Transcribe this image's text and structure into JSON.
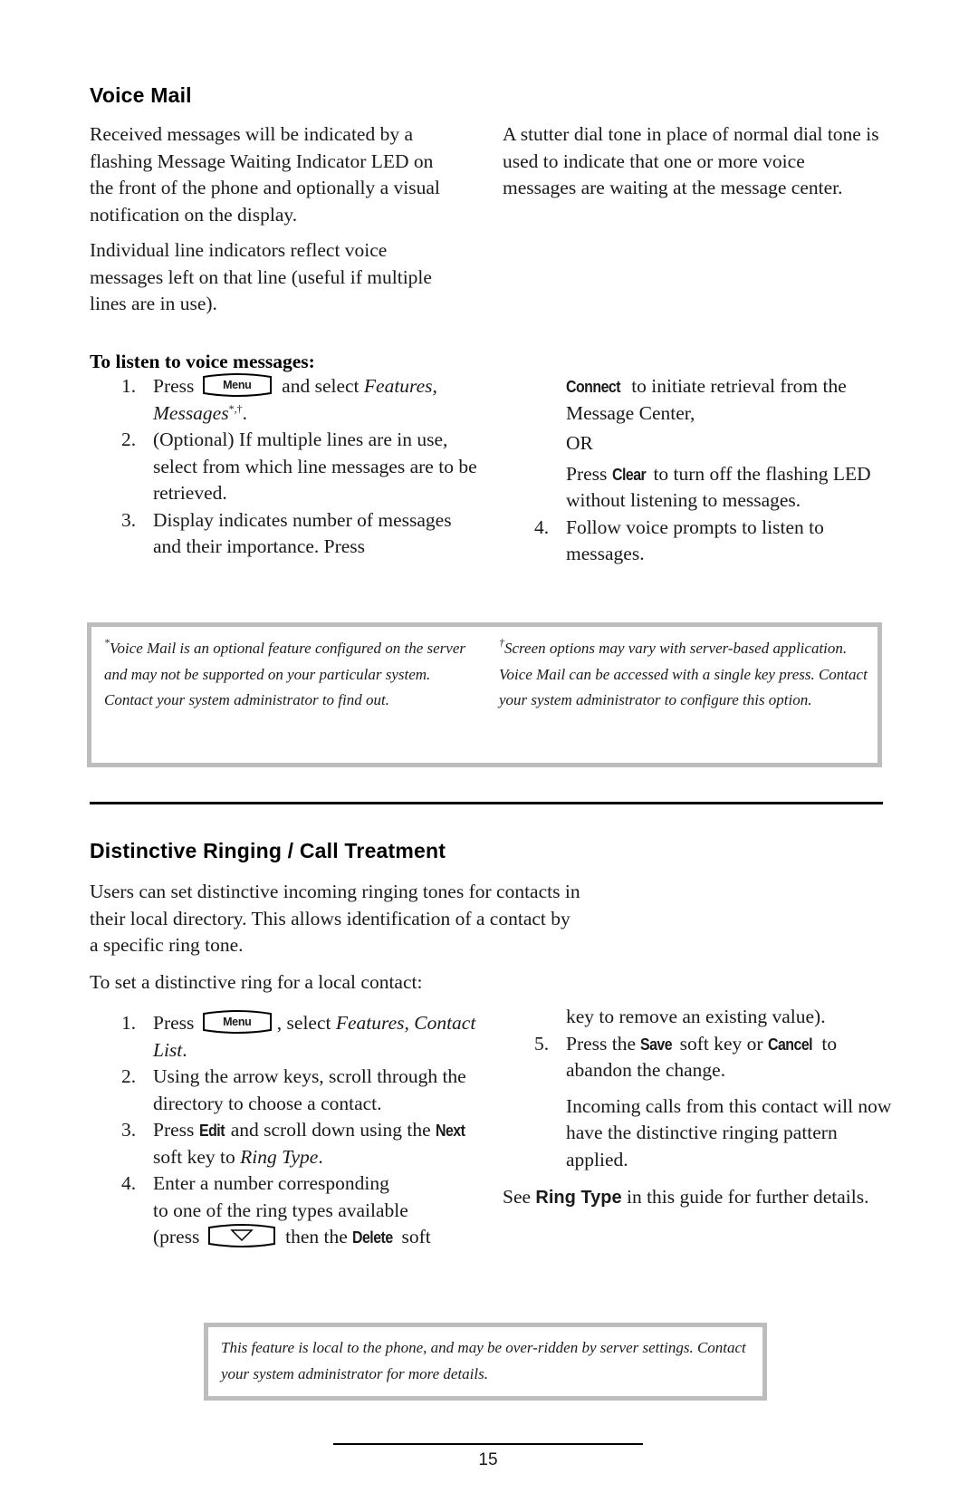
{
  "voice_mail": {
    "title": "Voice Mail",
    "intro_p1": "Received messages will be indicated by a flashing Message Waiting Indicator LED on the front of the phone and optionally a visual notification on the display.",
    "intro_p2": "Individual line indicators reflect voice messages left on that line (useful if multiple lines are in use).",
    "right_p1": "A stutter dial tone in place of normal dial tone is used to indicate that one or more voice messages are waiting at the message center.",
    "steps_heading": "To listen to voice messages:",
    "step1": {
      "num": "1.",
      "pre": "Press",
      "key": "Menu",
      "post": "and select",
      "italic": "Features, Messages",
      "sup": "*,†",
      "end": "."
    },
    "step2": {
      "num": "2.",
      "text": "(Optional)  If multiple lines are in use, select from which line messages are to be retrieved."
    },
    "step3": {
      "num": "3.",
      "text": "Display indicates number of messages and their importance.  Press",
      "key_connect": "Connect",
      "cont": "to initiate retrieval from the Message Center,",
      "or": "OR",
      "press": "Press",
      "key_clear": "Clear",
      "clear_text": "to turn off the flashing LED without listening to messages."
    },
    "step4": {
      "num": "4.",
      "text": "Follow voice prompts to listen to messages."
    },
    "footnote_left": {
      "mark": "*",
      "text": "Voice Mail is an optional feature configured on the server and may not be supported on your particular system.  Contact your system administrator to find out."
    },
    "footnote_right": {
      "mark": "†",
      "text": "Screen options may vary with server-based application.  Voice Mail can be accessed with a single key press.  Contact your system administrator to configure this option."
    }
  },
  "distinctive": {
    "title": "Distinctive Ringing / Call Treatment",
    "intro": "Users can set distinctive incoming ringing tones for contacts in their local directory.  This allows identification of a contact by a specific ring tone.",
    "lead": "To set a distinctive ring for a local contact:",
    "step1": {
      "num": "1.",
      "pre": "Press",
      "key": "Menu",
      "post": ", select",
      "italic": "Features, Contact List",
      "end": "."
    },
    "step2": {
      "num": "2.",
      "text": "Using the arrow keys, scroll through the directory to choose a contact."
    },
    "step3": {
      "num": "3.",
      "pre": "Press",
      "key_edit": "Edit",
      "mid": "and scroll down using the",
      "key_next": "Next",
      "post": "soft key to",
      "italic": "Ring Type",
      "end": "."
    },
    "step4": {
      "num": "4.",
      "text": "Enter a number corresponding to one of the ring types available (press",
      "key_icon": "down-arrow-key",
      "mid": "then the",
      "key_delete": "Delete",
      "end": "soft key to remove an existing value)."
    },
    "step5": {
      "num": "5.",
      "pre": "Press the",
      "key_save": "Save",
      "mid": "soft key or",
      "key_cancel": "Cancel",
      "end": "to abandon the change."
    },
    "result": "Incoming calls from this contact will now have the distinctive ringing pattern applied.",
    "see_pre": "See",
    "see_ref": "Ring Type",
    "see_post": "in this guide for further details.",
    "note": "This feature is local to the phone, and may be over-ridden by server settings.  Contact your system administrator for more details."
  },
  "footer": {
    "page_number": "15"
  }
}
